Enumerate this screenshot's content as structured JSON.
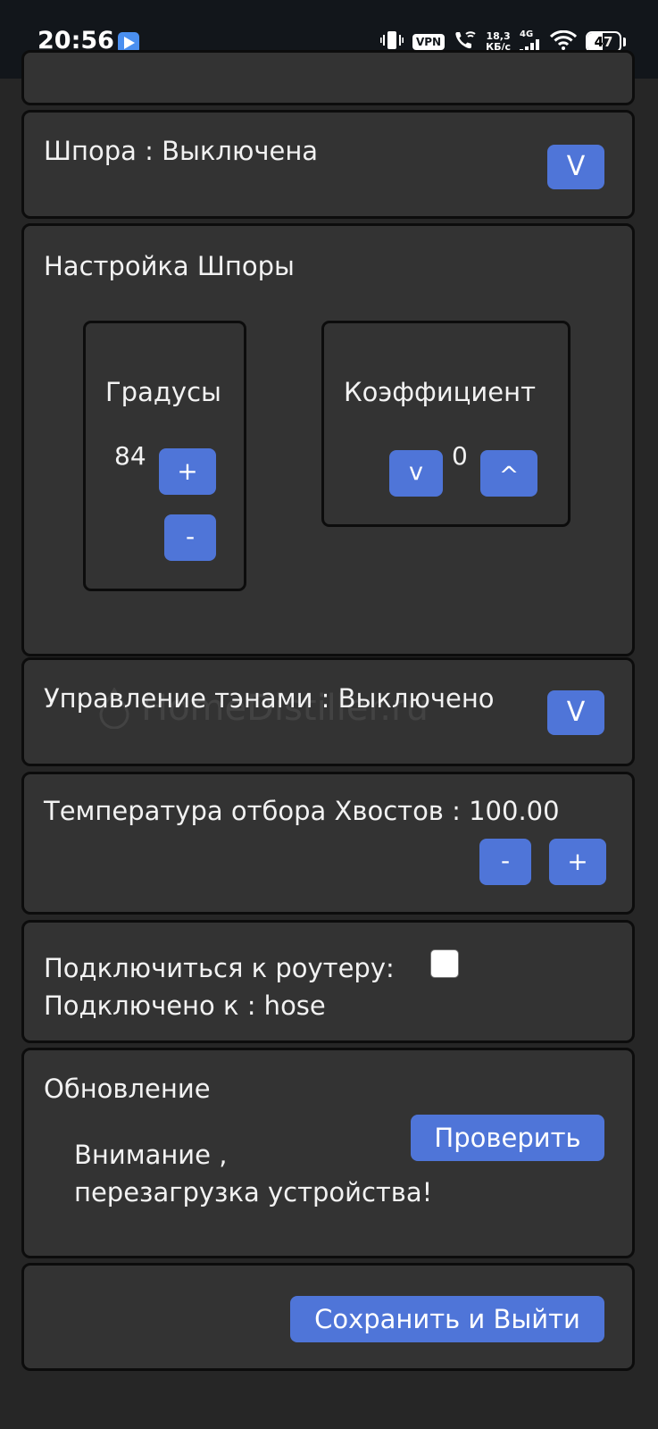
{
  "status_bar": {
    "time": "20:56",
    "vpn": "VPN",
    "speed_value": "18,3",
    "speed_unit": "КБ/с",
    "network": "4G",
    "battery": "47",
    "battery_level": 0.47,
    "icons": [
      "play-icon",
      "vibrate-icon",
      "vpn-badge",
      "wifi-call-icon",
      "signal-icon",
      "wifi-icon",
      "battery-icon"
    ]
  },
  "spur": {
    "label": "Шпора : Выключена",
    "toggle_label": "V"
  },
  "spur_settings": {
    "title": "Настройка Шпоры",
    "degrees": {
      "label": "Градусы",
      "value": "84",
      "plus_label": "+",
      "minus_label": "-"
    },
    "coefficient": {
      "label": "Коэффициент",
      "value": "0",
      "down_label": "v",
      "up_label": "^"
    }
  },
  "heaters": {
    "label": "Управление тэнами : Выключено",
    "toggle_label": "V"
  },
  "watermark": "HomeDistiller.ru",
  "tails_temp": {
    "label": "Температура отбора Хвостов : 100.00",
    "minus_label": "-",
    "plus_label": "+"
  },
  "router": {
    "connect_label": "Подключиться к роутеру:",
    "connect_checked": false,
    "connected_label": "Подключено к : hose"
  },
  "update": {
    "title": "Обновление",
    "check_label": "Проверить",
    "warning_line1": "Внимание ,",
    "warning_line2": "перезагрузка устройства!"
  },
  "footer": {
    "save_exit_label": "Сохранить и Выйти"
  },
  "colors": {
    "accent": "#4f75d8",
    "card_bg": "#333333",
    "page_bg": "#262626",
    "status_bar_bg": "#12161b"
  }
}
